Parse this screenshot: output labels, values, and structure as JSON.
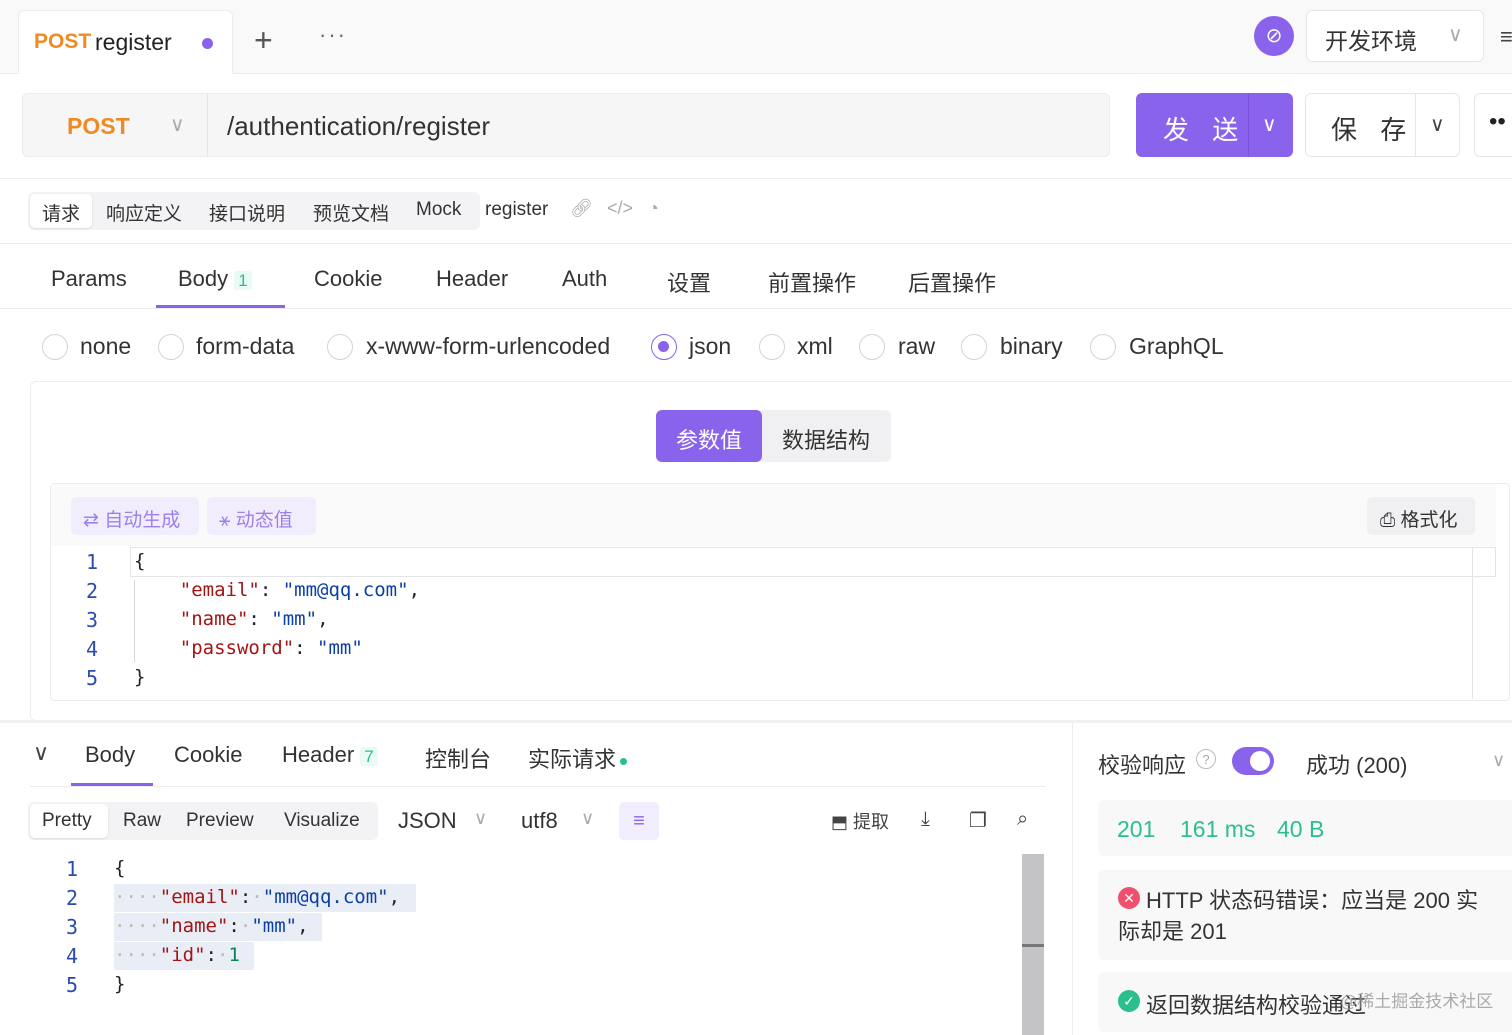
{
  "tab": {
    "method": "POST",
    "name": "register"
  },
  "env": {
    "label": "开发环境"
  },
  "request": {
    "method": "POST",
    "url": "/authentication/register",
    "send_label": "发 送",
    "save_label": "保 存"
  },
  "doc_tabs": {
    "items": [
      "请求",
      "响应定义",
      "接口说明",
      "预览文档",
      "Mock"
    ],
    "name": "register"
  },
  "req_tabs": {
    "items": [
      "Params",
      "Body",
      "Cookie",
      "Header",
      "Auth",
      "设置",
      "前置操作",
      "后置操作"
    ],
    "body_badge": "1"
  },
  "body_types": [
    "none",
    "form-data",
    "x-www-form-urlencoded",
    "json",
    "xml",
    "raw",
    "binary",
    "GraphQL"
  ],
  "body_mode": {
    "param_value": "参数值",
    "data_struct": "数据结构"
  },
  "body_tools": {
    "auto_gen": "自动生成",
    "dynamic": "动态值",
    "format": "格式化"
  },
  "request_body": {
    "line_numbers": [
      "1",
      "2",
      "3",
      "4",
      "5"
    ],
    "email_key": "\"email\"",
    "email_val": "\"mm@qq.com\"",
    "name_key": "\"name\"",
    "name_val": "\"mm\"",
    "password_key": "\"password\"",
    "password_val": "\"mm\""
  },
  "response_tabs": {
    "items": [
      "Body",
      "Cookie",
      "Header",
      "控制台",
      "实际请求"
    ],
    "header_badge": "7"
  },
  "view_modes": [
    "Pretty",
    "Raw",
    "Preview",
    "Visualize"
  ],
  "response_format": {
    "type": "JSON",
    "encoding": "utf8",
    "extract": "提取"
  },
  "response_body": {
    "line_numbers": [
      "1",
      "2",
      "3",
      "4",
      "5"
    ],
    "email_key": "\"email\"",
    "email_val": "\"mm@qq.com\"",
    "name_key": "\"name\"",
    "name_val": "\"mm\"",
    "id_key": "\"id\"",
    "id_val": "1"
  },
  "validation": {
    "label": "校验响应",
    "status_option": "成功 (200)",
    "status_code": "201",
    "time": "161 ms",
    "size": "40 B",
    "error_text": "HTTP 状态码错误：应当是 200 实际却是 201",
    "ok_text": "返回数据结构校验通过",
    "watermark": "@稀土掘金技术社区"
  },
  "colors": {
    "accent": "#8a63ec",
    "method": "#f08a24",
    "success": "#2bbf8e",
    "error": "#f0506e"
  }
}
